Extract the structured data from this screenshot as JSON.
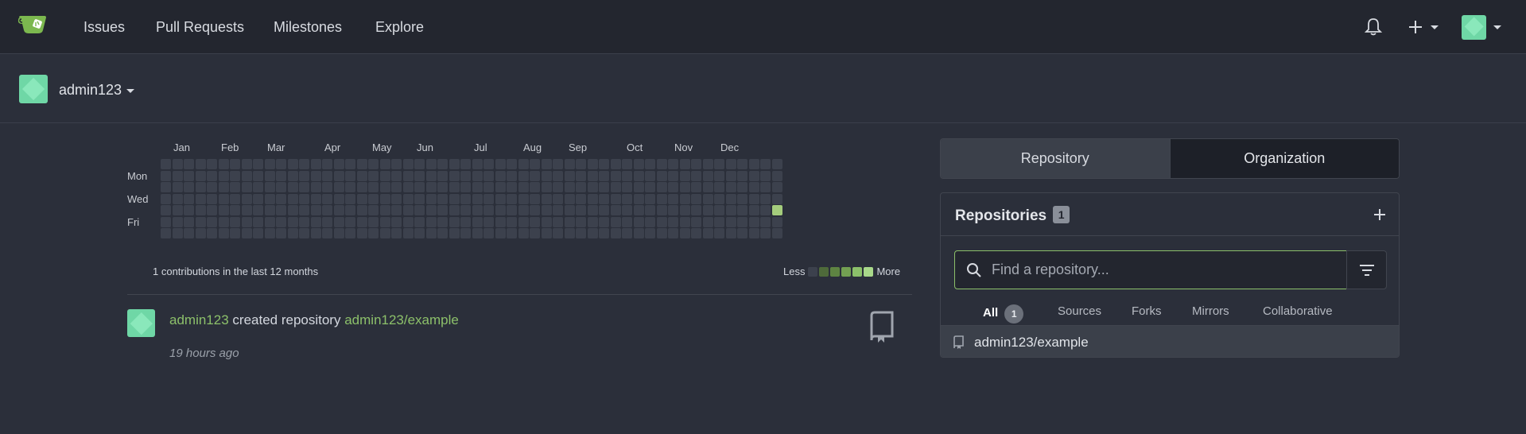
{
  "nav": {
    "links": [
      "Issues",
      "Pull Requests",
      "Milestones",
      "Explore"
    ]
  },
  "user": {
    "username": "admin123"
  },
  "heatmap": {
    "months": [
      "Jan",
      "Feb",
      "Mar",
      "Apr",
      "May",
      "Jun",
      "Jul",
      "Aug",
      "Sep",
      "Oct",
      "Nov",
      "Dec"
    ],
    "days": [
      "Mon",
      "Wed",
      "Fri"
    ],
    "summary": "1 contributions in the last 12 months",
    "legend_less": "Less",
    "legend_more": "More",
    "colors": {
      "empty": "#3c414d",
      "levels": [
        "#3c414d",
        "#4e6a3a",
        "#5e8442",
        "#73a052",
        "#8cc06a",
        "#a9d98a"
      ],
      "active": "#a4cc7c"
    },
    "active_cell": {
      "week": 53,
      "weekday": 4,
      "count": 1
    }
  },
  "feed": {
    "actor": "admin123",
    "action": "created repository",
    "target": "admin123/example",
    "time": "19 hours ago"
  },
  "panel": {
    "tabs": [
      "Repository",
      "Organization"
    ],
    "title": "Repositories",
    "count": "1",
    "search_placeholder": "Find a repository...",
    "filters": [
      "All",
      "Sources",
      "Forks",
      "Mirrors",
      "Collaborative"
    ],
    "all_count": "1",
    "repos": [
      "admin123/example"
    ]
  }
}
